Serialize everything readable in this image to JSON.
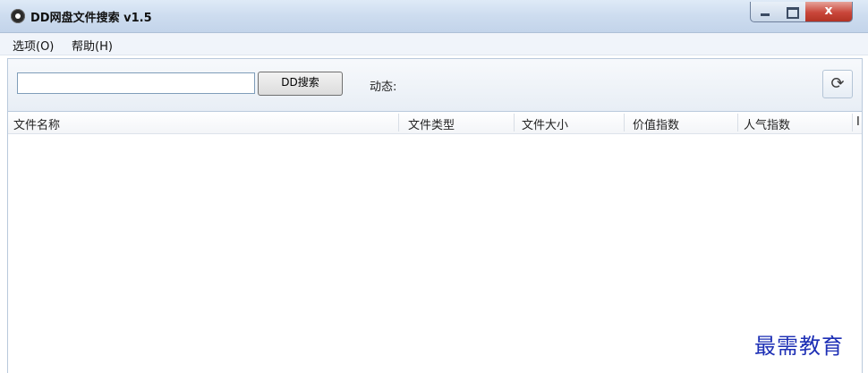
{
  "window": {
    "title": "DD网盘文件搜索 v1.5",
    "close_glyph": "x"
  },
  "menu": {
    "items": [
      "选项(O)",
      "帮助(H)"
    ]
  },
  "toolbar": {
    "search_value": "",
    "search_button": "DD搜索",
    "status_label": "动态:",
    "refresh_icon": "refresh-icon"
  },
  "table": {
    "columns": [
      "文件名称",
      "文件类型",
      "文件大小",
      "价值指数",
      "人气指数",
      "I"
    ],
    "rows": []
  },
  "watermark": "最需教育"
}
